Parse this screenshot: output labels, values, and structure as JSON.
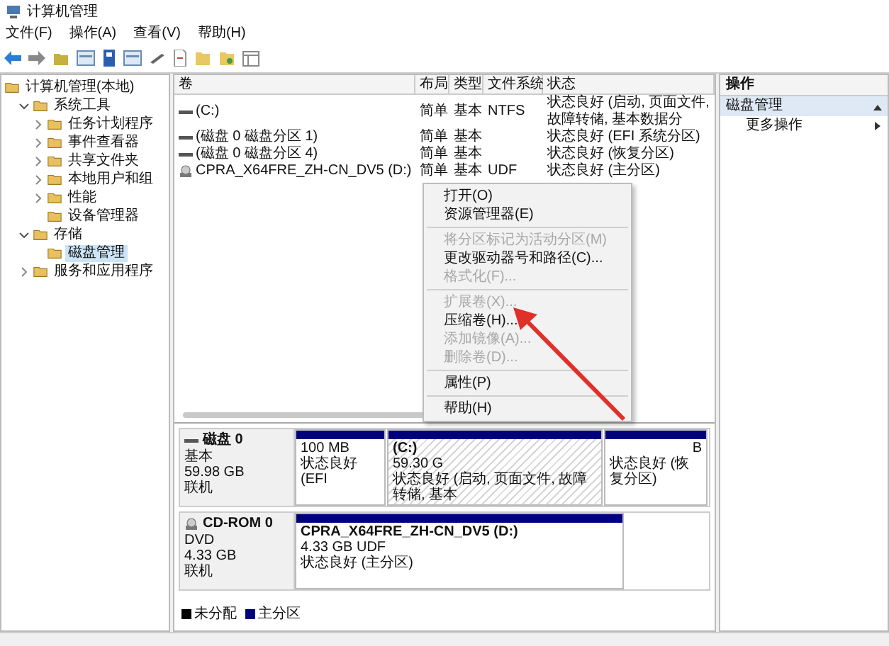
{
  "window": {
    "title": "计算机管理"
  },
  "menu_bar": [
    "文件(F)",
    "操作(A)",
    "查看(V)",
    "帮助(H)"
  ],
  "tree": [
    {
      "label": "计算机管理(本地)",
      "selected": false,
      "children": [
        {
          "label": "系统工具",
          "expanded": true,
          "selected": false,
          "children": [
            {
              "label": "任务计划程序",
              "expanded": false,
              "selected": false
            },
            {
              "label": "事件查看器",
              "expanded": false,
              "selected": false
            },
            {
              "label": "共享文件夹",
              "expanded": false,
              "selected": false
            },
            {
              "label": "本地用户和组",
              "expanded": false,
              "selected": false
            },
            {
              "label": "性能",
              "expanded": false,
              "selected": false
            },
            {
              "label": "设备管理器",
              "selected": false
            }
          ]
        },
        {
          "label": "存储",
          "expanded": true,
          "selected": false,
          "children": [
            {
              "label": "磁盘管理",
              "selected": true
            }
          ]
        },
        {
          "label": "服务和应用程序",
          "expanded": false,
          "selected": false
        }
      ]
    }
  ],
  "volume_table": {
    "columns": [
      "卷",
      "布局",
      "类型",
      "文件系统",
      "状态"
    ],
    "rows": [
      {
        "kind": "disk",
        "cells": [
          "(C:)",
          "简单",
          "基本",
          "NTFS",
          "状态良好 (启动, 页面文件, 故障转储, 基本数据分"
        ]
      },
      {
        "kind": "disk",
        "cells": [
          "(磁盘 0 磁盘分区 1)",
          "简单",
          "基本",
          "",
          "状态良好 (EFI 系统分区)"
        ]
      },
      {
        "kind": "disk",
        "cells": [
          "(磁盘 0 磁盘分区 4)",
          "简单",
          "基本",
          "",
          "状态良好 (恢复分区)"
        ]
      },
      {
        "kind": "cdrom",
        "cells": [
          "CPRA_X64FRE_ZH-CN_DV5 (D:)",
          "简单",
          "基本",
          "UDF",
          "状态良好 (主分区)"
        ]
      }
    ]
  },
  "context_menu": [
    {
      "kind": "item",
      "label": "打开(O)",
      "disabled": false
    },
    {
      "kind": "item",
      "label": "资源管理器(E)",
      "disabled": false
    },
    {
      "kind": "separator"
    },
    {
      "kind": "item",
      "label": "将分区标记为活动分区(M)",
      "disabled": true
    },
    {
      "kind": "item",
      "label": "更改驱动器号和路径(C)...",
      "disabled": false
    },
    {
      "kind": "item",
      "label": "格式化(F)...",
      "disabled": true
    },
    {
      "kind": "separator"
    },
    {
      "kind": "item",
      "label": "扩展卷(X)...",
      "disabled": true
    },
    {
      "kind": "item",
      "label": "压缩卷(H)...",
      "disabled": false
    },
    {
      "kind": "item",
      "label": "添加镜像(A)...",
      "disabled": true
    },
    {
      "kind": "item",
      "label": "删除卷(D)...",
      "disabled": true
    },
    {
      "kind": "separator"
    },
    {
      "kind": "item",
      "label": "属性(P)",
      "disabled": false
    },
    {
      "kind": "separator"
    },
    {
      "kind": "item",
      "label": "帮助(H)",
      "disabled": false
    }
  ],
  "disks": [
    {
      "kind": "disk",
      "name": "磁盘 0",
      "info": [
        "基本",
        "59.98 GB",
        "联机"
      ],
      "partitions": [
        {
          "selected": false,
          "lines": [
            "100 MB",
            "状态良好 (EFI"
          ]
        },
        {
          "selected": true,
          "title": "(C:)",
          "lines": [
            "59.30 G",
            "状态良好 (启动, 页面文件, 故障转储, 基本"
          ]
        },
        {
          "selected": false,
          "lines": [
            "B",
            "状态良好 (恢复分区)"
          ]
        }
      ]
    },
    {
      "kind": "cdrom",
      "name": "CD-ROM 0",
      "info": [
        "DVD",
        "4.33 GB",
        "联机"
      ],
      "partitions": [
        {
          "selected": false,
          "title": "CPRA_X64FRE_ZH-CN_DV5  (D:)",
          "lines": [
            "4.33 GB UDF",
            "状态良好 (主分区)"
          ]
        }
      ]
    }
  ],
  "legend": [
    {
      "label": "未分配",
      "color": "#000000"
    },
    {
      "label": "主分区",
      "color": "#00007f"
    }
  ],
  "actions": {
    "header": "操作",
    "section": "磁盘管理",
    "items": [
      "更多操作"
    ]
  }
}
